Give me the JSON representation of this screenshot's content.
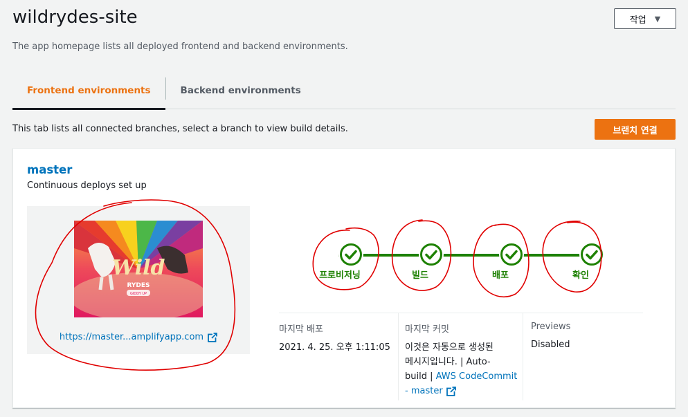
{
  "header": {
    "title": "wildrydes-site",
    "actions_label": "작업",
    "subtitle": "The app homepage lists all deployed frontend and backend environments."
  },
  "tabs": [
    {
      "label": "Frontend environments",
      "active": true
    },
    {
      "label": "Backend environments",
      "active": false
    }
  ],
  "tab_description": "This tab lists all connected branches, select a branch to view build details.",
  "connect_branch_label": "브랜치 연결",
  "branch": {
    "name": "master",
    "subtitle": "Continuous deploys set up",
    "preview_url": "https://master...amplifyapp.com",
    "thumbnail_text": {
      "title": "Wild",
      "subtitle": "RYDES",
      "button": "GIDDY UP"
    }
  },
  "pipeline": {
    "steps": [
      {
        "label": "프로비저닝",
        "status": "success"
      },
      {
        "label": "빌드",
        "status": "success"
      },
      {
        "label": "배포",
        "status": "success"
      },
      {
        "label": "확인",
        "status": "success"
      }
    ]
  },
  "details": {
    "last_deploy": {
      "label": "마지막 배포",
      "value": "2021. 4. 25. 오후 1:11:05"
    },
    "last_commit": {
      "label": "마지막 커밋",
      "line1": "이것은 자동으로 생성된",
      "line2": "메시지입니다. | Auto-",
      "line3": "build |",
      "link": "AWS CodeCommit",
      "link_tail": "- master"
    },
    "previews": {
      "label": "Previews",
      "value": "Disabled"
    }
  },
  "colors": {
    "accent": "#ec7211",
    "link": "#0073bb",
    "success": "#1d8102",
    "annotation": "#e00000"
  }
}
